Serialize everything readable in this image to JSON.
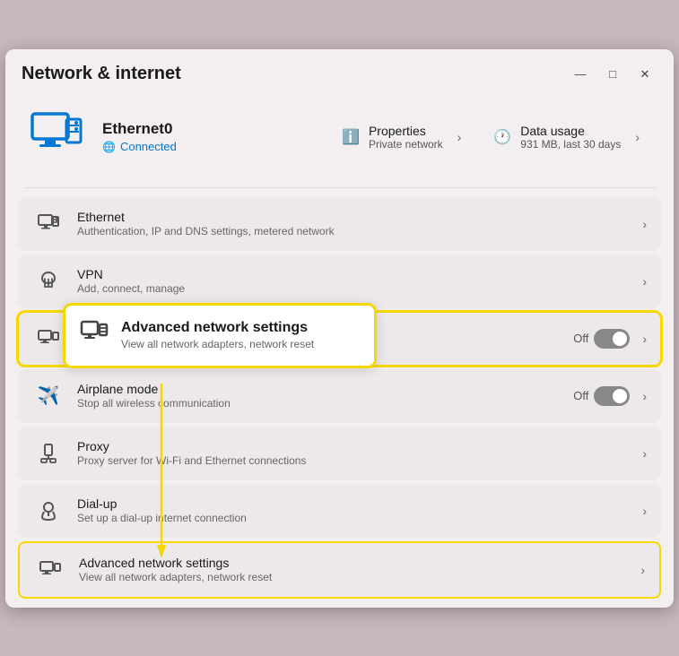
{
  "window": {
    "title": "Network & internet",
    "controls": {
      "minimize": "—",
      "maximize": "□",
      "close": "✕"
    }
  },
  "header": {
    "device_name": "Ethernet0",
    "status": "Connected",
    "properties_label": "Properties",
    "properties_sublabel": "Private network",
    "data_usage_label": "Data usage",
    "data_usage_sublabel": "931 MB, last 30 days"
  },
  "list_items": [
    {
      "id": "ethernet",
      "title": "Ethernet",
      "subtitle": "Authentication, IP and DNS settings, metered network",
      "has_toggle": false,
      "toggle_label": "",
      "toggle_state": false
    },
    {
      "id": "vpn",
      "title": "VPN",
      "subtitle": "Add, connect, manage",
      "has_toggle": false,
      "toggle_label": "",
      "toggle_state": false
    },
    {
      "id": "advanced-network-settings",
      "title": "Advanced network settings",
      "subtitle": "View all network adapters, network reset",
      "has_toggle": false,
      "toggle_label": "",
      "toggle_state": false,
      "highlighted": true
    },
    {
      "id": "mobile-hotspot",
      "title": "Airplane mode",
      "subtitle": "Stop all wireless communication",
      "has_toggle": true,
      "toggle_label": "Off",
      "toggle_state": false
    },
    {
      "id": "proxy",
      "title": "Proxy",
      "subtitle": "Proxy server for Wi-Fi and Ethernet connections",
      "has_toggle": false,
      "toggle_label": "",
      "toggle_state": false
    },
    {
      "id": "dialup",
      "title": "Dial-up",
      "subtitle": "Set up a dial-up internet connection",
      "has_toggle": false,
      "toggle_label": "",
      "toggle_state": false
    },
    {
      "id": "advanced-network-settings-2",
      "title": "Advanced network settings",
      "subtitle": "View all network adapters, network reset",
      "has_toggle": false,
      "toggle_label": "",
      "toggle_state": false,
      "highlighted": true
    }
  ],
  "callout": {
    "title": "Advanced network settings",
    "subtitle": "View all network adapters, network reset"
  },
  "icons": {
    "ethernet": "🖥",
    "vpn": "🛡",
    "advanced_network": "💻",
    "airplane": "✈",
    "proxy": "📡",
    "dialup": "📞",
    "info": "ℹ",
    "clock": "🕐",
    "globe": "🌐"
  }
}
